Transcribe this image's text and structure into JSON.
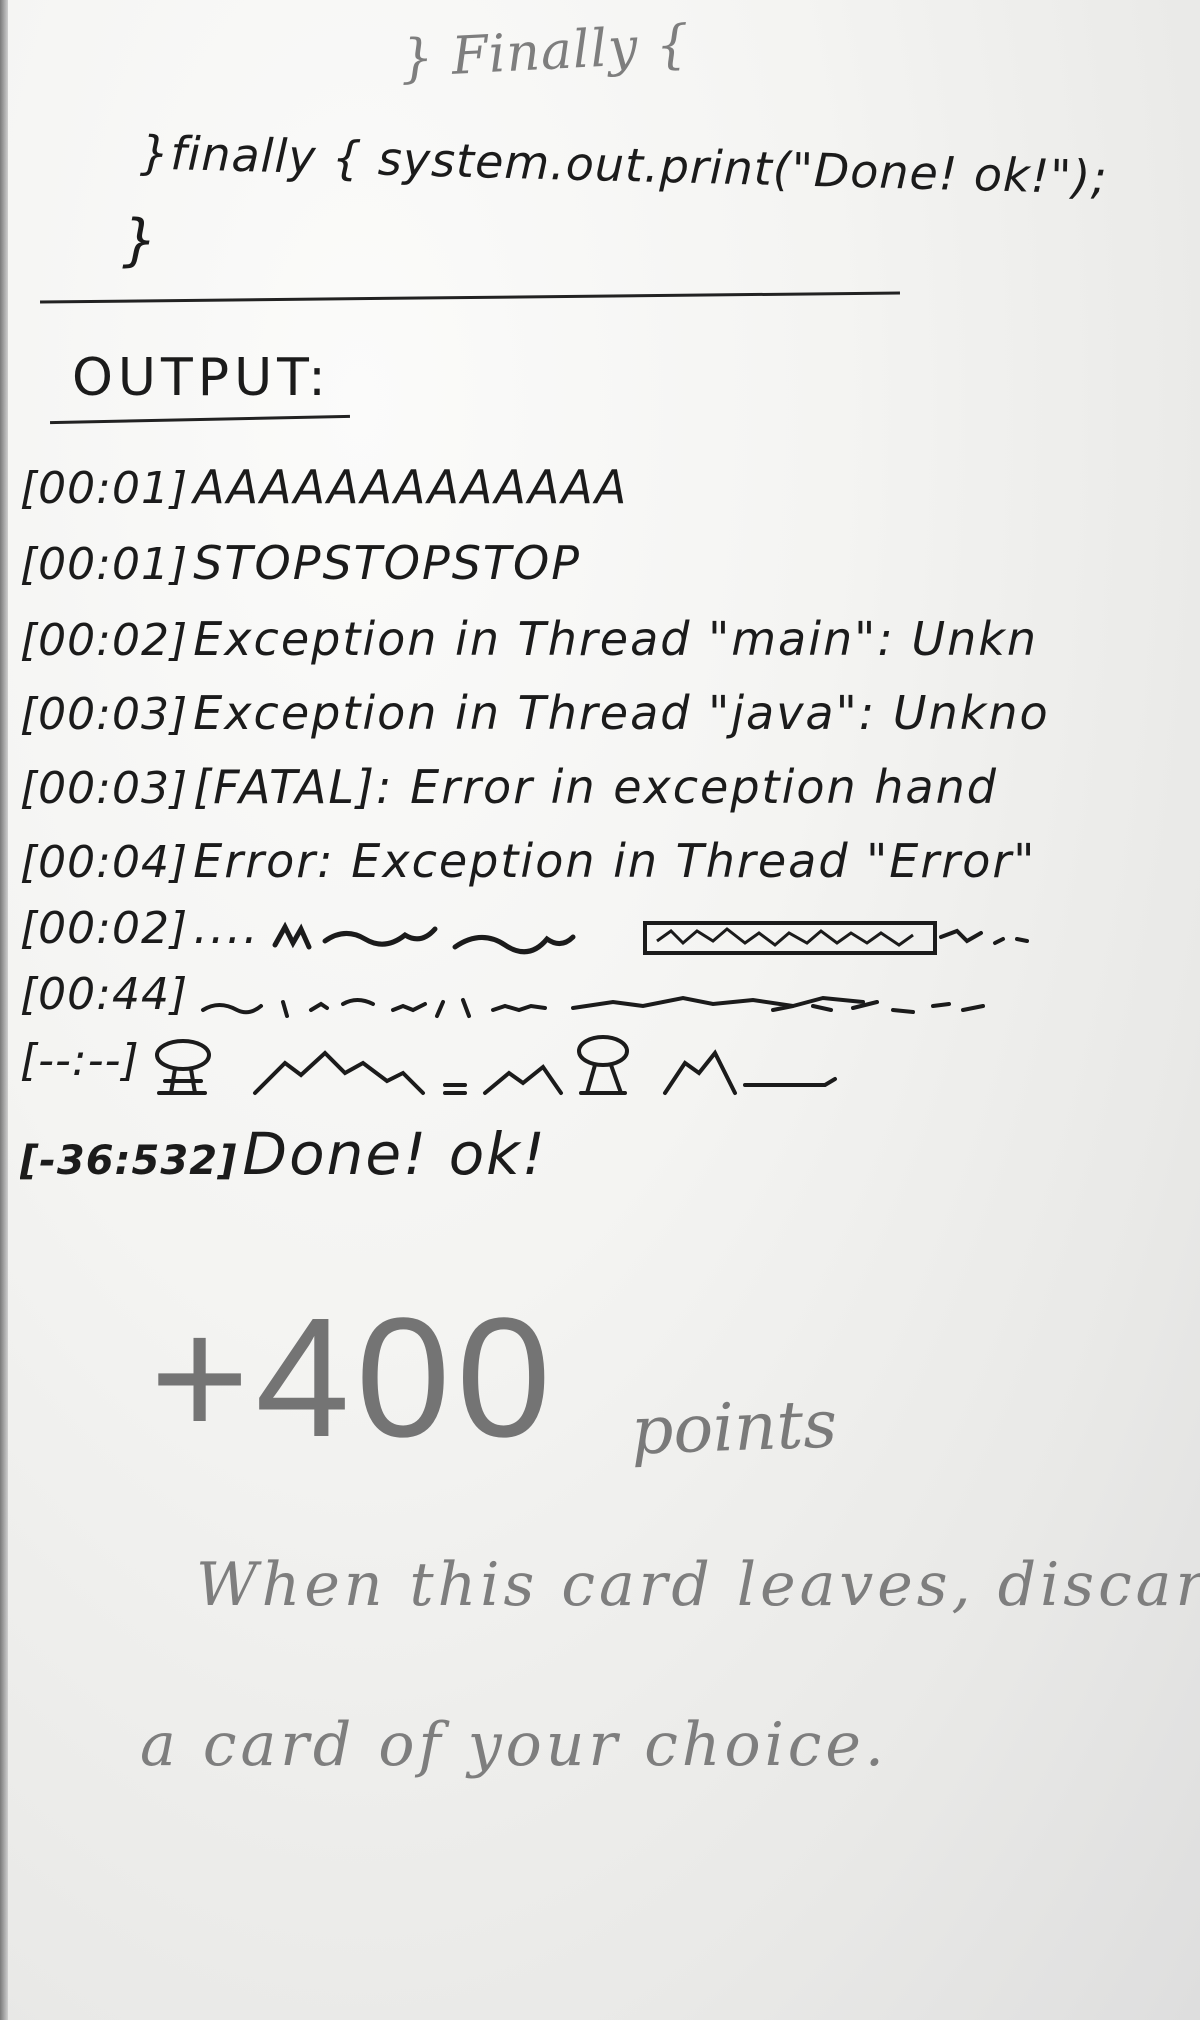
{
  "code": {
    "pencil_line": "} Finally {",
    "ink_line": "}finally { system.out.print(\"Done! ok!\");",
    "closing_brace": "}"
  },
  "output": {
    "heading": "OUTPUT:",
    "lines": [
      {
        "stamp": "[00:01]",
        "text": "AAAAAAAAAAAAA"
      },
      {
        "stamp": "[00:01]",
        "text": "STOPSTOPSTOP"
      },
      {
        "stamp": "[00:02]",
        "text": "Exception in Thread \"main\": Unkn"
      },
      {
        "stamp": "[00:03]",
        "text": "Exception in Thread \"java\": Unkno"
      },
      {
        "stamp": "[00:03]",
        "text": "[FATAL]: Error in exception hand"
      },
      {
        "stamp": "[00:04]",
        "text": "Error: Exception in Thread \"Error\""
      },
      {
        "stamp": "[00:02]",
        "text": "...."
      },
      {
        "stamp": "[00:44]",
        "text": ""
      },
      {
        "stamp": "[--:--]",
        "text": ""
      },
      {
        "stamp": "[-36:532]",
        "text": "Done! ok!"
      }
    ]
  },
  "reward": {
    "value": "+400",
    "unit": "points"
  },
  "ability": {
    "line1": "When this card leaves, discard",
    "line2": "a card of your choice."
  },
  "colors": {
    "ink": "#1b1b1b",
    "pencil": "#7e7e7e",
    "paper": "#f4f4f2"
  }
}
